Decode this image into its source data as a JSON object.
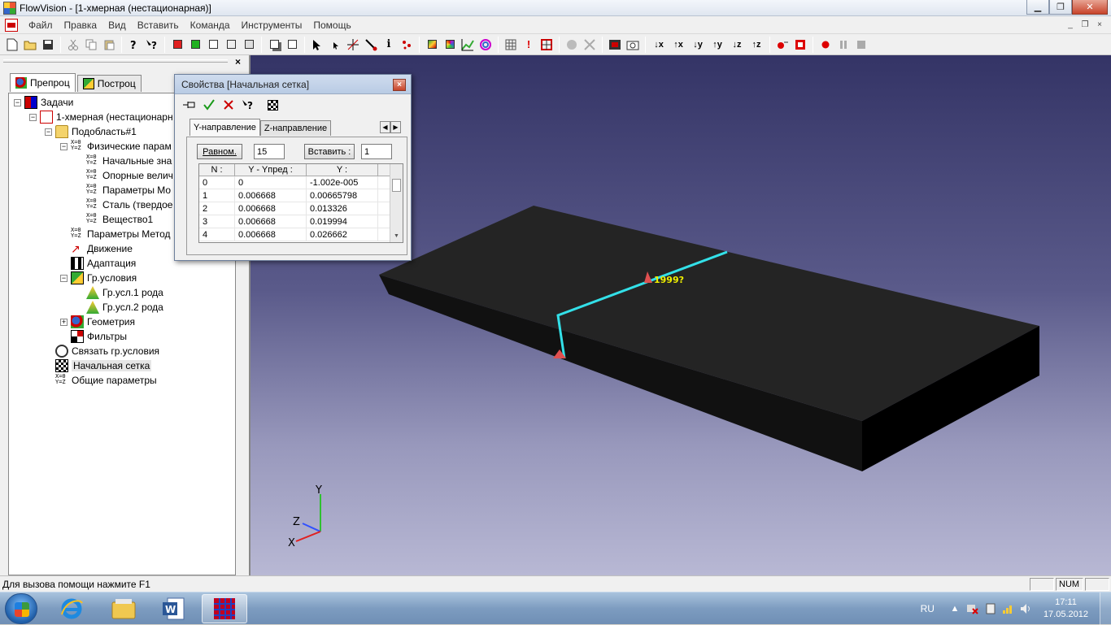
{
  "window": {
    "title": "FlowVision - [1-хмерная (нестационарная)]",
    "minimize_glyph": "▁",
    "restore_glyph": "❐",
    "close_glyph": "✕"
  },
  "menu": {
    "items": [
      "Файл",
      "Правка",
      "Вид",
      "Вставить",
      "Команда",
      "Инструменты",
      "Помощь"
    ],
    "mdi_minimize": "_",
    "mdi_restore": "❐",
    "mdi_close": "×"
  },
  "toolbar": {
    "info_label": "i",
    "axis_x_down": "↓x",
    "axis_x_up": "↑x",
    "axis_y_down": "↓y",
    "axis_y_up": "↑y",
    "axis_z_down": "↓z",
    "axis_z_up": "↑z"
  },
  "left_panel": {
    "close_glyph": "×",
    "tabs": [
      "Препроц",
      "Построц"
    ],
    "tree": [
      {
        "label": "Задачи",
        "icon": "grid-icon",
        "level": 0,
        "expander": "−"
      },
      {
        "label": "1-хмерная (нестационарн",
        "icon": "project-icon",
        "level": 1,
        "expander": "−"
      },
      {
        "label": "Подобласть#1",
        "icon": "folder-icon",
        "level": 2,
        "expander": "−"
      },
      {
        "label": "Физические парам",
        "icon": "params-icon",
        "level": 3,
        "expander": "−"
      },
      {
        "label": "Начальные зна",
        "icon": "params-icon",
        "level": 4,
        "expander": ""
      },
      {
        "label": "Опорные велич",
        "icon": "params-icon",
        "level": 4,
        "expander": ""
      },
      {
        "label": "Параметры Мо",
        "icon": "params-icon",
        "level": 4,
        "expander": ""
      },
      {
        "label": "Сталь (твердое",
        "icon": "params-icon",
        "level": 4,
        "expander": ""
      },
      {
        "label": "Вещество1",
        "icon": "params-icon",
        "level": 4,
        "expander": ""
      },
      {
        "label": "Параметры Метод",
        "icon": "params-icon",
        "level": 3,
        "expander": ""
      },
      {
        "label": "Движение",
        "icon": "motion-icon",
        "level": 3,
        "expander": ""
      },
      {
        "label": "Адаптация",
        "icon": "adaptation-icon",
        "level": 3,
        "expander": ""
      },
      {
        "label": "Гр.условия",
        "icon": "boundary-icon",
        "level": 3,
        "expander": "−"
      },
      {
        "label": "Гр.усл.1 рода",
        "icon": "cone-icon",
        "level": 4,
        "expander": ""
      },
      {
        "label": "Гр.усл.2 рода",
        "icon": "cone-icon",
        "level": 4,
        "expander": ""
      },
      {
        "label": "Геометрия",
        "icon": "geometry-icon",
        "level": 3,
        "expander": "+"
      },
      {
        "label": "Фильтры",
        "icon": "filter-icon",
        "level": 3,
        "expander": ""
      },
      {
        "label": "Связать гр.условия",
        "icon": "link-icon",
        "level": 2,
        "expander": ""
      },
      {
        "label": "Начальная сетка",
        "icon": "mesh-icon",
        "level": 2,
        "expander": "",
        "selected": true
      },
      {
        "label": "Общие параметры",
        "icon": "params-icon",
        "level": 2,
        "expander": ""
      }
    ]
  },
  "dialog": {
    "title": "Свойства [Начальная сетка]",
    "close_glyph": "×",
    "tabs": [
      "Y-направление",
      "Z-направление"
    ],
    "scroll_left": "◀",
    "scroll_right": "▶",
    "uniform_button": "Равном.",
    "uniform_value": "15",
    "insert_button": "Вставить :",
    "insert_value": "1",
    "columns": [
      "N :",
      "Y - Yпред :",
      "Y :"
    ],
    "rows": [
      [
        "0",
        "0",
        "-1.002e-005"
      ],
      [
        "1",
        "0.006668",
        "0.00665798"
      ],
      [
        "2",
        "0.006668",
        "0.013326"
      ],
      [
        "3",
        "0.006668",
        "0.019994"
      ],
      [
        "4",
        "0.006668",
        "0.026662"
      ]
    ]
  },
  "viewport": {
    "label_text": "1999?",
    "axis_labels": {
      "y": "Y",
      "z": "Z",
      "x": "X"
    },
    "box_color": "#1e1e1e",
    "line_color": "#33e0e8"
  },
  "status": {
    "help_text": "Для вызова помощи нажмите F1",
    "num": "NUM"
  },
  "taskbar": {
    "lang": "RU",
    "time": "17:11",
    "date": "17.05.2012"
  }
}
